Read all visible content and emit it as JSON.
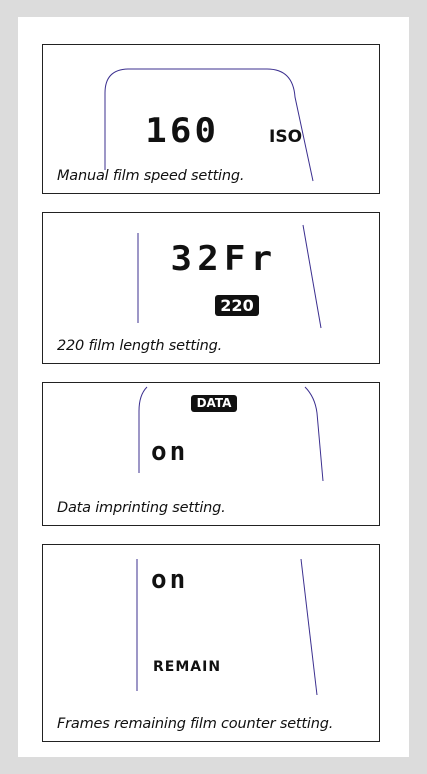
{
  "cards": [
    {
      "display": "160",
      "indicator": "ISO",
      "caption": "Manual film speed setting."
    },
    {
      "display": "32Fr",
      "badge": "220",
      "caption": "220 film length setting."
    },
    {
      "badge": "DATA",
      "display": "on",
      "caption": "Data imprinting setting."
    },
    {
      "display": "on",
      "indicator": "REMAIN",
      "caption": "Frames remaining film counter setting."
    }
  ],
  "colors": {
    "border": "#222222",
    "line": "#3b2f8f",
    "background": "#dcdcdc"
  }
}
